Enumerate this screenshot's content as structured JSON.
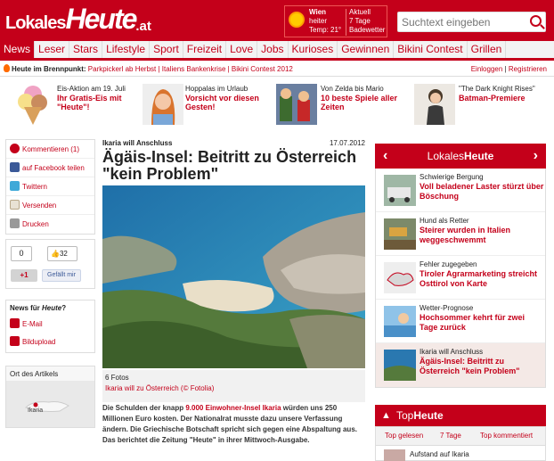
{
  "header": {
    "logo_part1": "Lokales",
    "logo_part2": "Heute",
    "logo_part3": ".at",
    "weather": {
      "city": "Wien",
      "condition": "heiter",
      "temp": "Temp: 21°",
      "col2_title": "Aktuell",
      "col2_days": "7 Tage",
      "col2_link": "Badewetter"
    },
    "search": {
      "placeholder": "Suchtext eingeben"
    }
  },
  "nav": {
    "items": [
      "News",
      "Leser",
      "Stars",
      "Lifestyle",
      "Sport",
      "Freizeit",
      "Love",
      "Jobs",
      "Kurioses",
      "Gewinnen",
      "Bikini Contest",
      "Grillen"
    ]
  },
  "brennpunkt": {
    "label": "Heute im Brennpunkt:",
    "links": "Parkpickerl ab Herbst | Italiens Bankenkrise | Bikini Contest 2012",
    "login": "Einloggen",
    "sep": "|",
    "register": "Registrieren"
  },
  "teasers": [
    {
      "sub": "Eis-Aktion am 19. Juli",
      "title": "Ihr Gratis-Eis mit \"Heute\"!"
    },
    {
      "sub": "Hoppalas im Urlaub",
      "title": "Vorsicht vor diesen Gesten!"
    },
    {
      "sub": "Von Zelda bis Mario",
      "title": "10 beste Spiele aller Zeiten"
    },
    {
      "sub": "\"The Dark Knight Rises\"",
      "title": "Batman-Premiere"
    }
  ],
  "left": {
    "share": [
      "Kommentieren (1)",
      "auf Facebook teilen",
      "Twittern",
      "Versenden",
      "Drucken"
    ],
    "like_count": "0",
    "fb_count": "32",
    "gplus": "+1",
    "fb_like": "Gefällt mir",
    "news_for": "News für ",
    "news_for_em": "Heute",
    "news_for_q": "?",
    "email": "E-Mail",
    "upload": "Bildupload",
    "location_title": "Ort des Artikels",
    "map_label": "Ikaria"
  },
  "article": {
    "kicker": "Ikaria will Anschluss",
    "date": "17.07.2012",
    "headline": "Ägäis-Insel: Beitritt zu Österreich \"kein Problem\"",
    "fotos": "6 Fotos",
    "caption": "Ikaria will zu Österreich (© Fotolia)",
    "body_before": "Die Schulden der knapp ",
    "body_link": "9.000 Einwohner-Insel Ikaria",
    "body_after": " würden uns 250 Millionen Euro kosten. Der Nationalrat musste dazu unsere Verfassung ändern. Die Griechische Botschaft spricht sich gegen eine Abspaltung aus. Das berichtet die Zeitung \"Heute\" in ihrer Mittwoch-Ausgabe."
  },
  "right": {
    "head_pre": "Lokales",
    "head_bold": "Heute",
    "items": [
      {
        "kicker": "Schwierige Bergung",
        "title": "Voll beladener Laster stürzt über Böschung"
      },
      {
        "kicker": "Hund als Retter",
        "title": "Steirer wurden in Italien weggeschwemmt"
      },
      {
        "kicker": "Fehler zugegeben",
        "title": "Tiroler Agrarmarketing streicht Osttirol von Karte"
      },
      {
        "kicker": "Wetter-Prognose",
        "title": "Hochsommer kehrt für zwei Tage zurück"
      },
      {
        "kicker": "Ikaria will Anschluss",
        "title": "Ägäis-Insel: Beitritt zu Österreich \"kein Problem\""
      }
    ],
    "top_pre": "Top",
    "top_bold": "Heute",
    "tabs": [
      "Top gelesen",
      "7 Tage",
      "Top kommentiert"
    ],
    "first_entry": "Aufstand auf Ikaria"
  },
  "colors": {
    "brand": "#c4001a"
  }
}
